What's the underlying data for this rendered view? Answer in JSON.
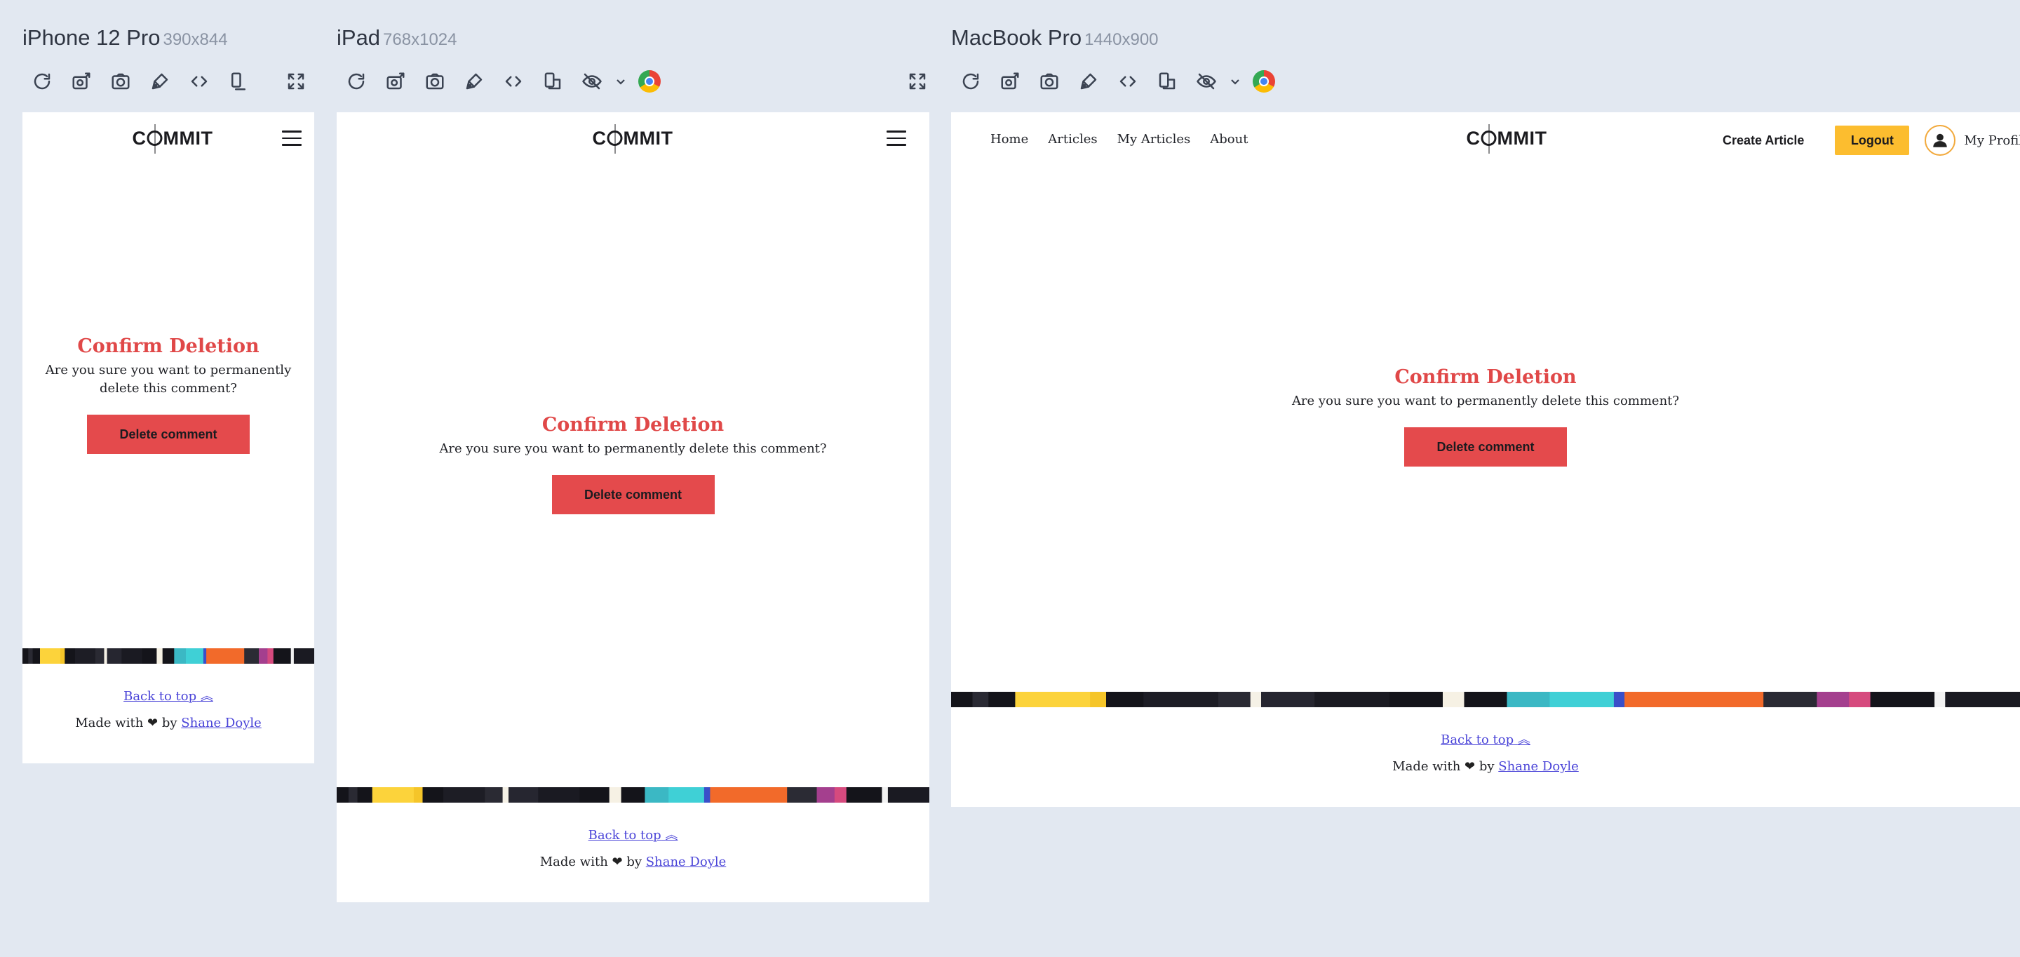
{
  "devices": [
    {
      "name": "iPhone 12 Pro",
      "size": "390x844"
    },
    {
      "name": "iPad",
      "size": "768x1024"
    },
    {
      "name": "MacBook Pro",
      "size": "1440x900"
    }
  ],
  "site": {
    "logo": {
      "pre": "C",
      "post": "MMIT"
    },
    "nav": {
      "links": [
        "Home",
        "Articles",
        "My Articles",
        "About"
      ],
      "create_article": "Create Article",
      "logout": "Logout",
      "my_profile": "My Profile"
    },
    "confirm": {
      "title": "Confirm Deletion",
      "text": "Are you sure you want to permanently delete this comment?",
      "button": "Delete comment"
    },
    "footer": {
      "back_to_top": "Back to top",
      "made_with_pre": "Made with",
      "made_with_mid": "by",
      "author": "Shane Doyle"
    }
  },
  "colors": {
    "accent_red": "#e44a4c",
    "title_red": "#e04848",
    "logout_yellow": "#fcbd2f",
    "link_purple": "#4a44d8",
    "canvas": "#e2e8f1"
  },
  "icons": [
    "refresh-icon",
    "screenshot-icon",
    "camera-icon",
    "paint-icon",
    "code-icon",
    "rotate-icon",
    "hide-icon",
    "extension-icon",
    "fullscreen-icon"
  ]
}
